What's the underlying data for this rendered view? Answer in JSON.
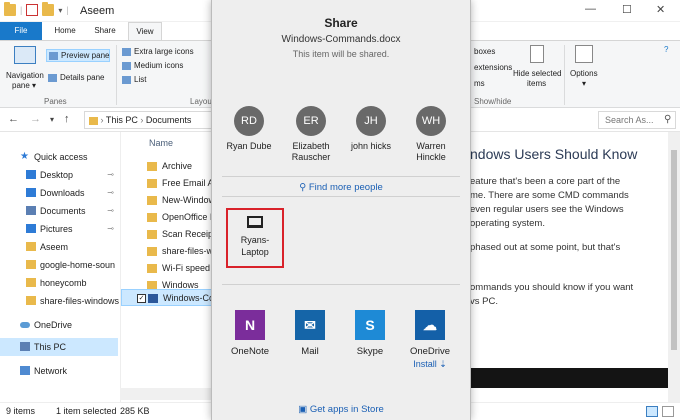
{
  "window": {
    "title": "Aseem",
    "minimize": "—",
    "maximize": "☐",
    "close": "✕"
  },
  "ribbon_tabs": [
    "File",
    "Home",
    "Share",
    "View"
  ],
  "ribbon": {
    "nav_pane_label": "Navigation",
    "nav_pane_label2": "pane ▾",
    "preview_pane": "Preview pane",
    "details_pane": "Details pane",
    "panes_group": "Panes",
    "extra_large_icons": "Extra large icons",
    "medium_icons": "Medium icons",
    "list": "List",
    "layout_group": "Layou",
    "boxes": "boxes",
    "extensions": "extensions",
    "ms": "ms",
    "hide_selected_1": "Hide selected",
    "hide_selected_2": "items",
    "show_hide_group": "Show/hide",
    "options": "Options",
    "options_caret": "▾"
  },
  "address": {
    "path": [
      "This PC",
      "Documents"
    ],
    "search_placeholder": "Search As..."
  },
  "nav": {
    "items": [
      {
        "label": "Quick access"
      },
      {
        "label": "Desktop"
      },
      {
        "label": "Downloads"
      },
      {
        "label": "Documents"
      },
      {
        "label": "Pictures"
      },
      {
        "label": "Aseem"
      },
      {
        "label": "google-home-soun"
      },
      {
        "label": "honeycomb"
      },
      {
        "label": "share-files-windows"
      },
      {
        "label": "OneDrive"
      },
      {
        "label": "This PC"
      },
      {
        "label": "Network"
      }
    ]
  },
  "files": {
    "header": "Name",
    "rows": [
      "Archive",
      "Free Email A",
      "New-Window",
      "OpenOffice I",
      "Scan Receipt",
      "share-files-w",
      "Wi-Fi speed",
      "Windows",
      "Windows-Co"
    ]
  },
  "preview": {
    "title": "ndows Users Should Know",
    "lines": [
      "eature that's been a core part of the",
      "me. There are some CMD commands",
      "even regular users see the Windows",
      "operating system.",
      "phased out at some point, but that's",
      "ommands you should know if you want",
      "vs PC."
    ]
  },
  "status": {
    "items_count": "9 items",
    "selected": "1 item selected",
    "size": "285 KB"
  },
  "share": {
    "title": "Share",
    "file_name": "Windows-Commands.docx",
    "subtitle": "This item will be shared.",
    "contacts": [
      {
        "initials": "RD",
        "name_1": "Ryan Dube",
        "name_2": ""
      },
      {
        "initials": "ER",
        "name_1": "Elizabeth",
        "name_2": "Rauscher"
      },
      {
        "initials": "JH",
        "name_1": "john hicks",
        "name_2": ""
      },
      {
        "initials": "WH",
        "name_1": "Warren",
        "name_2": "Hinckle"
      }
    ],
    "find_more": "Find more people",
    "device": {
      "name_1": "Ryans-",
      "name_2": "Laptop"
    },
    "apps": [
      {
        "name": "OneNote",
        "icon_text": "N",
        "color": "#7b2d9b"
      },
      {
        "name": "Mail",
        "icon_text": "✉",
        "color": "#1565a8"
      },
      {
        "name": "Skype",
        "icon_text": "S",
        "color": "#1e8ad6"
      },
      {
        "name": "OneDrive",
        "icon_text": "☁",
        "color": "#1460a8",
        "install": "Install ⇣"
      }
    ],
    "get_apps": "Get apps in Store"
  }
}
